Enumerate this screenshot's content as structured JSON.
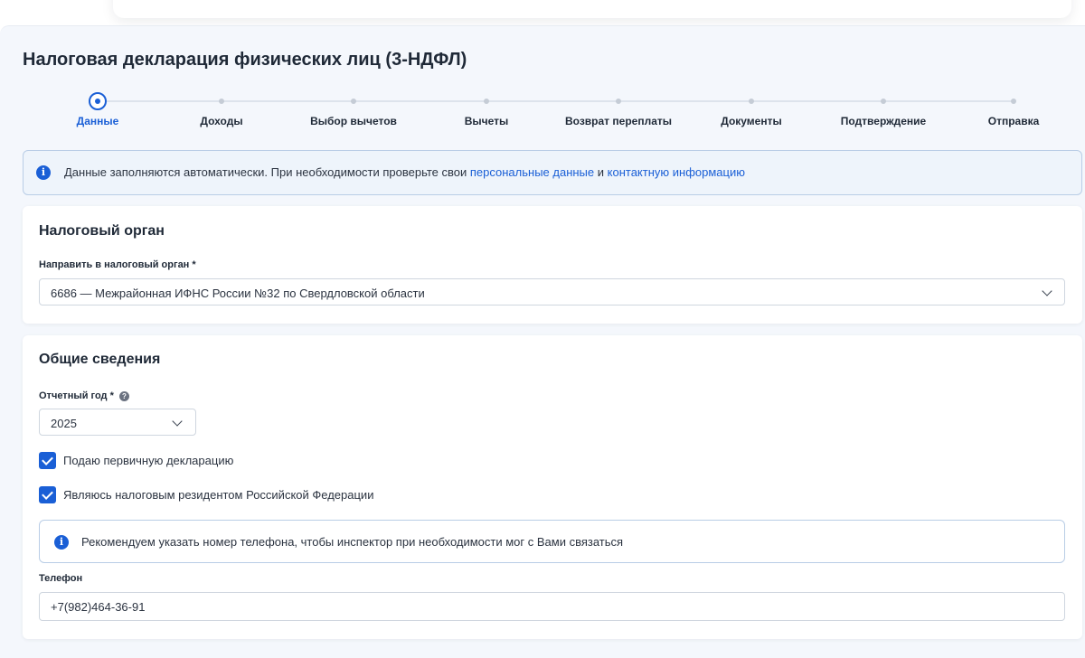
{
  "page": {
    "title": "Налоговая декларация физических лиц (3-НДФЛ)"
  },
  "stepper": {
    "steps": [
      {
        "label": "Данные",
        "active": true
      },
      {
        "label": "Доходы"
      },
      {
        "label": "Выбор вычетов"
      },
      {
        "label": "Вычеты"
      },
      {
        "label": "Возврат переплаты"
      },
      {
        "label": "Документы"
      },
      {
        "label": "Подтверждение"
      },
      {
        "label": "Отправка"
      }
    ]
  },
  "info_banner": {
    "text_before": "Данные заполняются автоматически. При необходимости проверьте свои ",
    "link_personal": "персональные данные",
    "text_middle": " и ",
    "link_contact": "контактную информацию"
  },
  "tax_authority": {
    "title": "Налоговый орган",
    "field_label": "Направить в налоговый орган *",
    "selected": "6686 — Межрайонная ИФНС России №32 по Свердловской области"
  },
  "general": {
    "title": "Общие сведения",
    "year_label": "Отчетный год *",
    "year_value": "2025",
    "checkbox_primary": "Подаю первичную декларацию",
    "checkbox_resident": "Являюсь налоговым резидентом Российской Федерации",
    "notice": "Рекомендуем указать номер телефона, чтобы инспектор при необходимости мог с Вами связаться",
    "phone_label": "Телефон",
    "phone_value": "+7(982)464-36-91"
  },
  "colors": {
    "accent": "#1a5fd6",
    "panel_bg": "#f4f7fc",
    "banner_bg": "#eef4fb"
  },
  "icons": {
    "info": "info-icon",
    "help": "question-icon",
    "dropdown": "chevron-down-icon",
    "checkbox": "check-icon"
  }
}
